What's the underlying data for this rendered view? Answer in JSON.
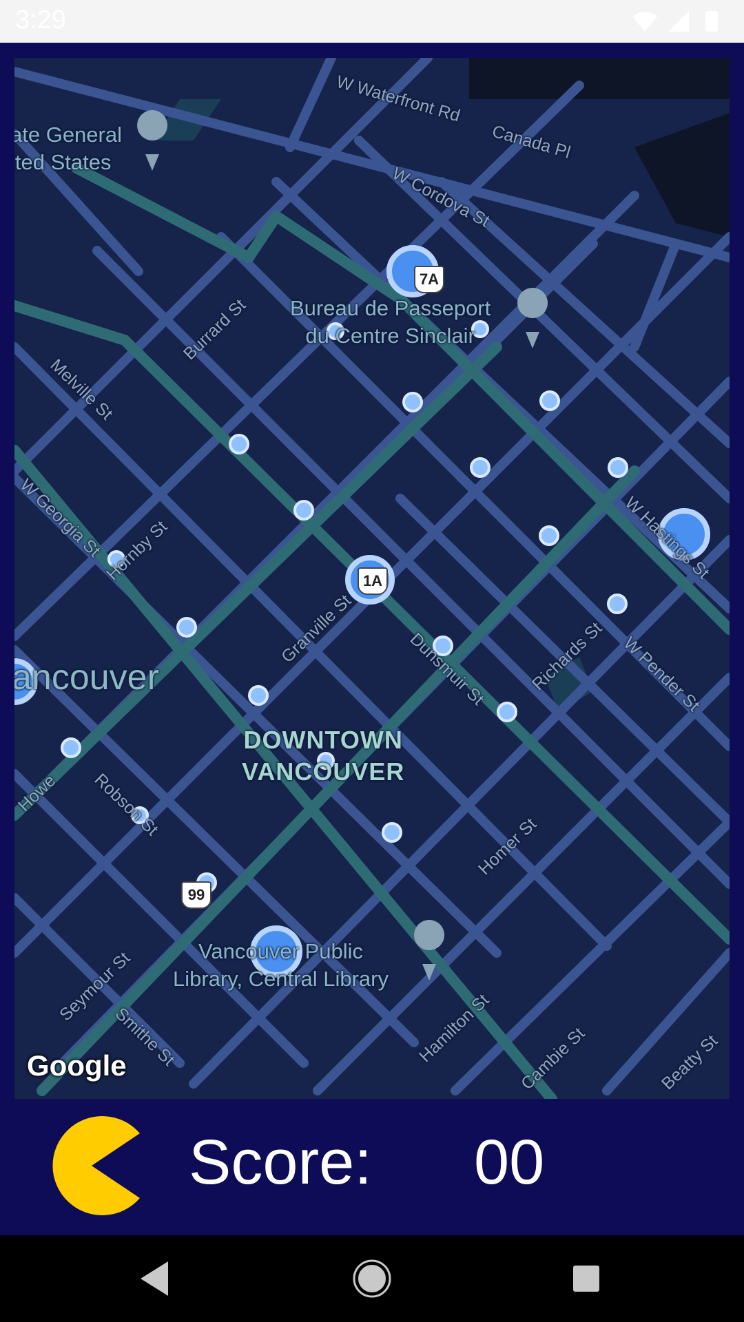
{
  "status_bar": {
    "time": "3:29",
    "icons": [
      "wifi-icon",
      "signal-icon",
      "battery-icon"
    ]
  },
  "map": {
    "attribution": "Google",
    "city_label": "ancouver",
    "district_label_line1": "DOWNTOWN",
    "district_label_line2": "VANCOUVER",
    "pois": [
      {
        "line1": "ate General",
        "line2": "ited States"
      },
      {
        "line1": "Bureau de Passeport",
        "line2": "du Centre Sinclair"
      },
      {
        "line1": "Vancouver Public",
        "line2": "Library, Central Library"
      }
    ],
    "streets": {
      "waterfront": "W Waterfront Rd",
      "canada_pl": "Canada Pl",
      "cordova": "W Cordova St",
      "burrard": "Burrard St",
      "melville": "Melville St",
      "georgia": "W Georgia St",
      "hornby": "Hornby St",
      "granville": "Granville St",
      "dunsmuir": "Dunsmuir St",
      "richards": "Richards St",
      "pender": "W Pender St",
      "hastings": "W Hastings St",
      "howe": "Howe",
      "robson": "Robson St",
      "homer": "Homer St",
      "seymour": "Seymour St",
      "smithe": "Smithe St",
      "hamilton": "Hamilton St",
      "cambie": "Cambie St",
      "beatty": "Beatty St"
    },
    "shields": {
      "hwy7a": "7A",
      "hwy1a": "1A",
      "hwy99": "99"
    }
  },
  "hud": {
    "score_label": "Score:",
    "score_value": "00"
  },
  "colors": {
    "background": "#0e0b57",
    "map_base": "#16234a",
    "street": "#3b5592",
    "transit": "#2f6b75",
    "pellet": "#8fc1ff",
    "power_pellet": "#4a90f0",
    "pacman": "#ffcc00"
  },
  "nav_bar": {
    "buttons": [
      "back-icon",
      "home-icon",
      "recents-icon"
    ]
  }
}
